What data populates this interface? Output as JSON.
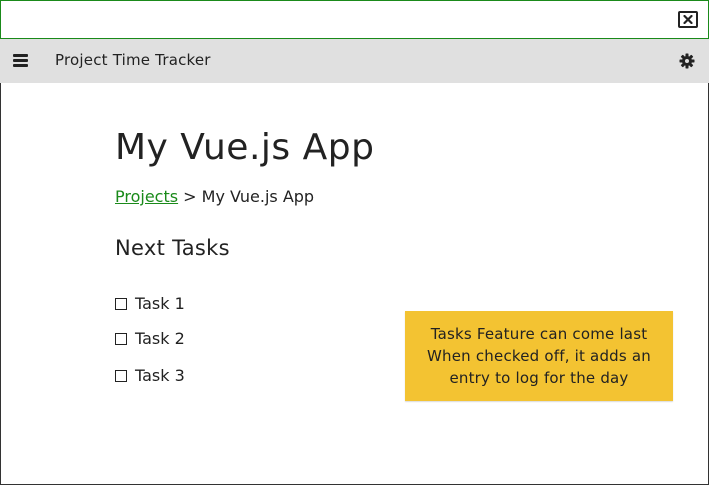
{
  "window": {
    "close_icon": "close-icon"
  },
  "header": {
    "title": "Project Time Tracker",
    "menu_icon": "hamburger-menu-icon",
    "settings_icon": "gear-icon",
    "background": "#e0e0e0"
  },
  "page": {
    "title": "My Vue.js App",
    "breadcrumb": {
      "link": "Projects",
      "separator": ">",
      "current": "My Vue.js App"
    },
    "section_heading": "Next Tasks",
    "tasks": [
      {
        "label": "Task 1",
        "checked": false
      },
      {
        "label": "Task 2",
        "checked": false
      },
      {
        "label": "Task 3",
        "checked": false
      }
    ]
  },
  "note": {
    "lines": [
      "Tasks Feature can come last",
      "When checked off, it adds an",
      "entry to log for the day"
    ],
    "color": "#f3c332"
  },
  "colors": {
    "accent": "#1a8a1a",
    "text": "#222222"
  }
}
